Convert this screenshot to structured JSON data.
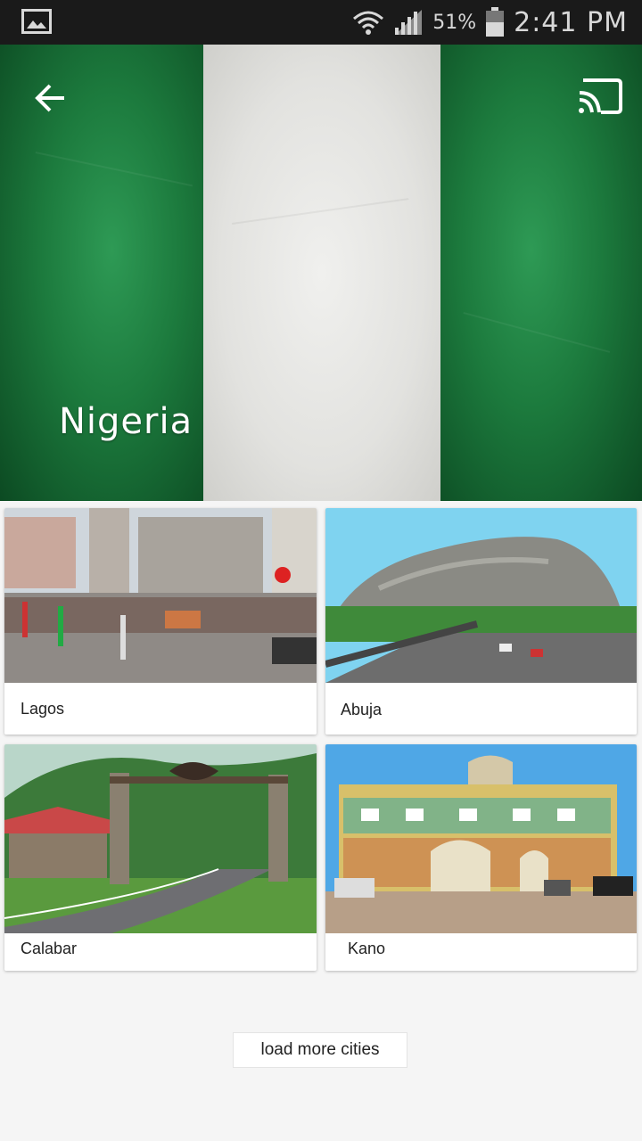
{
  "status_bar": {
    "battery_percent": "51%",
    "time": "2:41 PM",
    "icons": [
      "gallery-icon",
      "wifi-icon",
      "signal-icon",
      "battery-icon"
    ]
  },
  "header": {
    "title": "Nigeria",
    "back_icon": "arrow-back-icon",
    "cast_icon": "cast-icon",
    "flag_colors": {
      "green": "#1c7a3d",
      "white": "#e8e8e6"
    }
  },
  "cities": [
    {
      "name": "Lagos"
    },
    {
      "name": "Abuja"
    },
    {
      "name": "Calabar"
    },
    {
      "name": "Kano"
    }
  ],
  "footer": {
    "load_more_label": "load more cities"
  }
}
